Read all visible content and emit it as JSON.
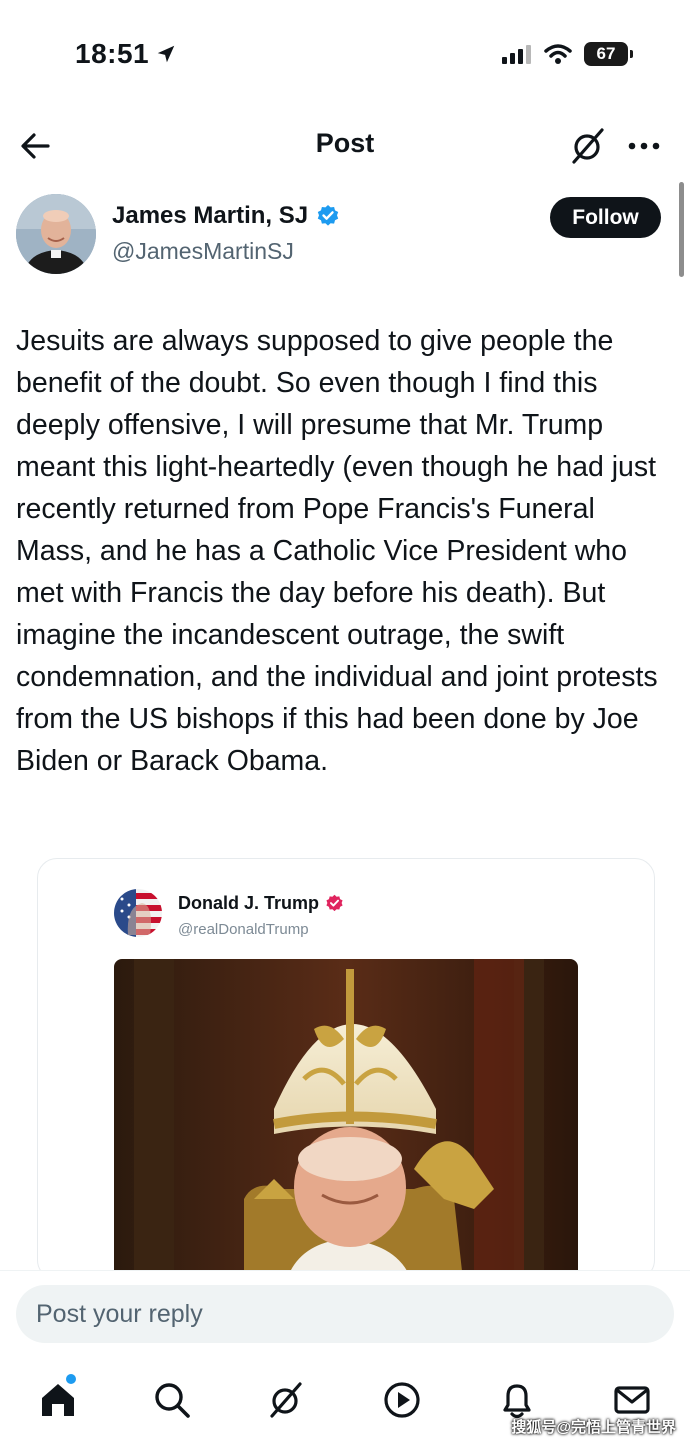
{
  "status_bar": {
    "time": "18:51",
    "battery": "67"
  },
  "header": {
    "title": "Post"
  },
  "author": {
    "name": "James Martin, SJ",
    "handle": "@JamesMartinSJ",
    "follow_label": "Follow"
  },
  "post": {
    "text": "Jesuits are always supposed to give people the benefit of the doubt. So even though I find this deeply offensive, I will presume that Mr. Trump meant this light-heartedly (even though he had just recently returned from Pope Francis's Funeral Mass, and he has a Catholic Vice President who met with Francis the day before his death). But imagine the incandescent outrage, the swift condemnation, and the individual and joint protests from the US bishops if this had been done by Joe Biden or Barack Obama."
  },
  "quoted": {
    "name": "Donald J. Trump",
    "handle": "@realDonaldTrump"
  },
  "reply": {
    "placeholder": "Post your reply"
  },
  "nav": {
    "icons": [
      "home-icon",
      "search-icon",
      "grok-icon",
      "video-icon",
      "notifications-icon",
      "messages-icon"
    ]
  },
  "watermark": "搜狐号@完悟上管青世界",
  "colors": {
    "verified_blue": "#1d9bf0",
    "verified_gov_red": "#e0245e",
    "text": "#0f1419",
    "muted": "#536471"
  }
}
